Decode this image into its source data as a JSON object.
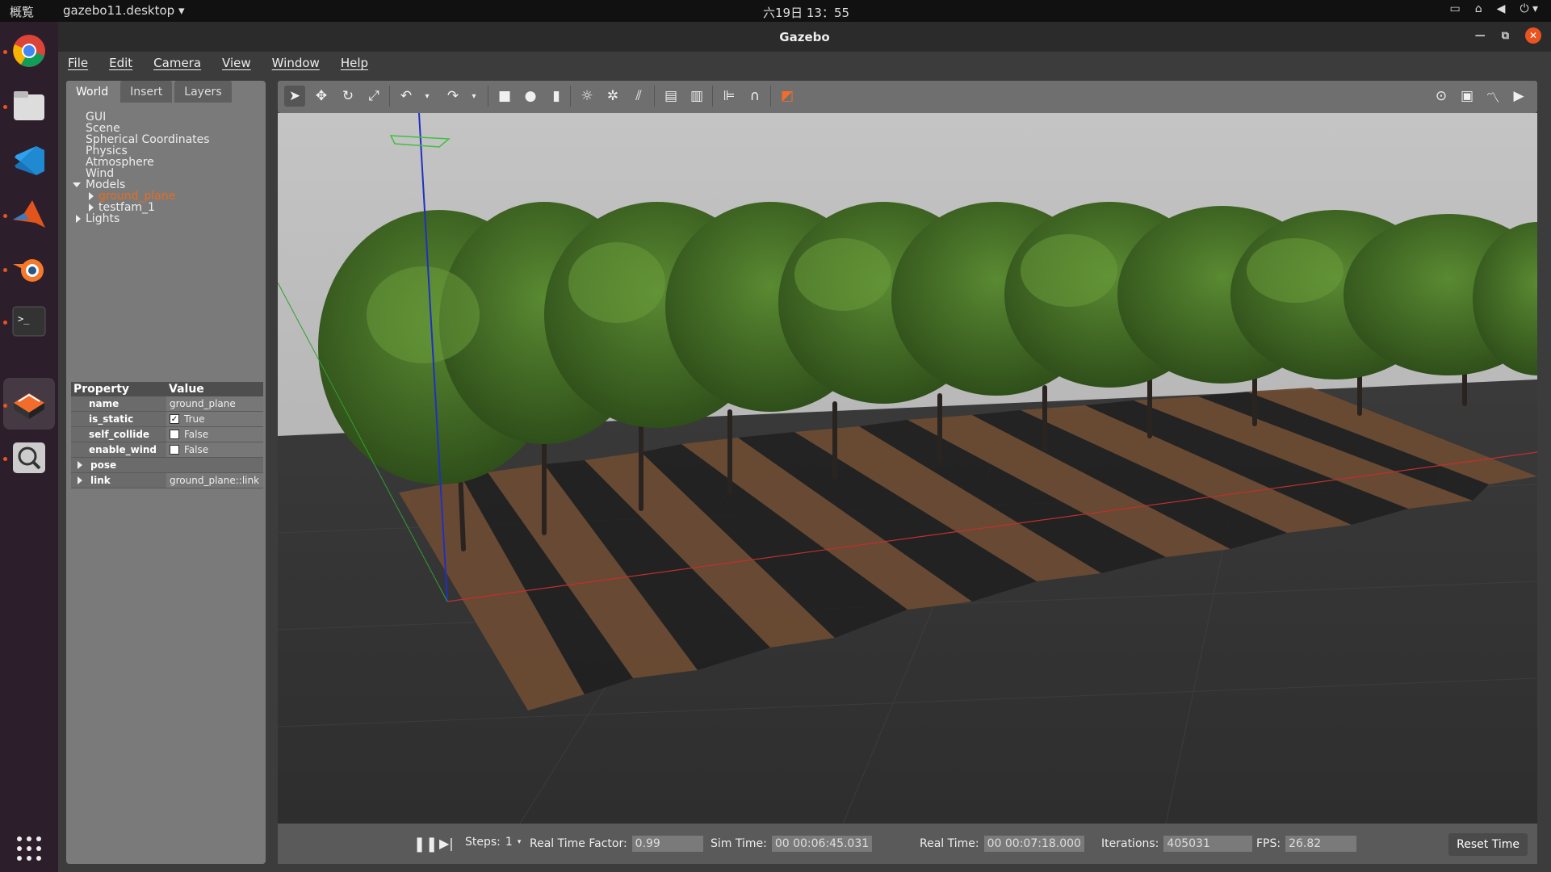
{
  "topbar": {
    "activities": "概覧",
    "app_menu": "gazebo11.desktop ▾",
    "clock": "六19日  13：55"
  },
  "window": {
    "title": "Gazebo"
  },
  "menu": {
    "items": [
      "File",
      "Edit",
      "Camera",
      "View",
      "Window",
      "Help"
    ]
  },
  "left_panel": {
    "tabs": [
      "World",
      "Insert",
      "Layers"
    ],
    "tree": {
      "gui": "GUI",
      "scene": "Scene",
      "spherical": "Spherical Coordinates",
      "physics": "Physics",
      "atmosphere": "Atmosphere",
      "wind": "Wind",
      "models": "Models",
      "ground_plane": "ground_plane",
      "testfam": "testfam_1",
      "lights": "Lights"
    },
    "properties": {
      "header_property": "Property",
      "header_value": "Value",
      "name_key": "name",
      "name_val": "ground_plane",
      "is_static_key": "is_static",
      "is_static_val": "True",
      "self_collide_key": "self_collide",
      "self_collide_val": "False",
      "enable_wind_key": "enable_wind",
      "enable_wind_val": "False",
      "pose_key": "pose",
      "link_key": "link",
      "link_val": "ground_plane::link"
    }
  },
  "bottom": {
    "steps_label": "Steps:",
    "steps_val": "1",
    "rtf_label": "Real Time Factor:",
    "rtf_val": "0.99",
    "sim_label": "Sim Time:",
    "sim_val": "00 00:06:45.031",
    "real_label": "Real Time:",
    "real_val": "00 00:07:18.000",
    "iter_label": "Iterations:",
    "iter_val": "405031",
    "fps_label": "FPS:",
    "fps_val": "26.82",
    "reset": "Reset Time"
  },
  "colors": {
    "accent": "#e95420",
    "selected_tree": "#e86c1f",
    "foliage": "#3f6a22"
  },
  "icons": {
    "toolbar": [
      "select-arrow-icon",
      "translate-icon",
      "rotate-icon",
      "scale-icon",
      "undo-icon",
      "redo-icon",
      "box-icon",
      "sphere-icon",
      "cylinder-icon",
      "point-light-icon",
      "spot-light-icon",
      "directional-light-icon",
      "copy-icon",
      "paste-icon",
      "align-icon",
      "snap-icon",
      "view-angle-icon",
      "screenshot-icon",
      "log-icon",
      "plot-icon",
      "record-icon"
    ]
  }
}
